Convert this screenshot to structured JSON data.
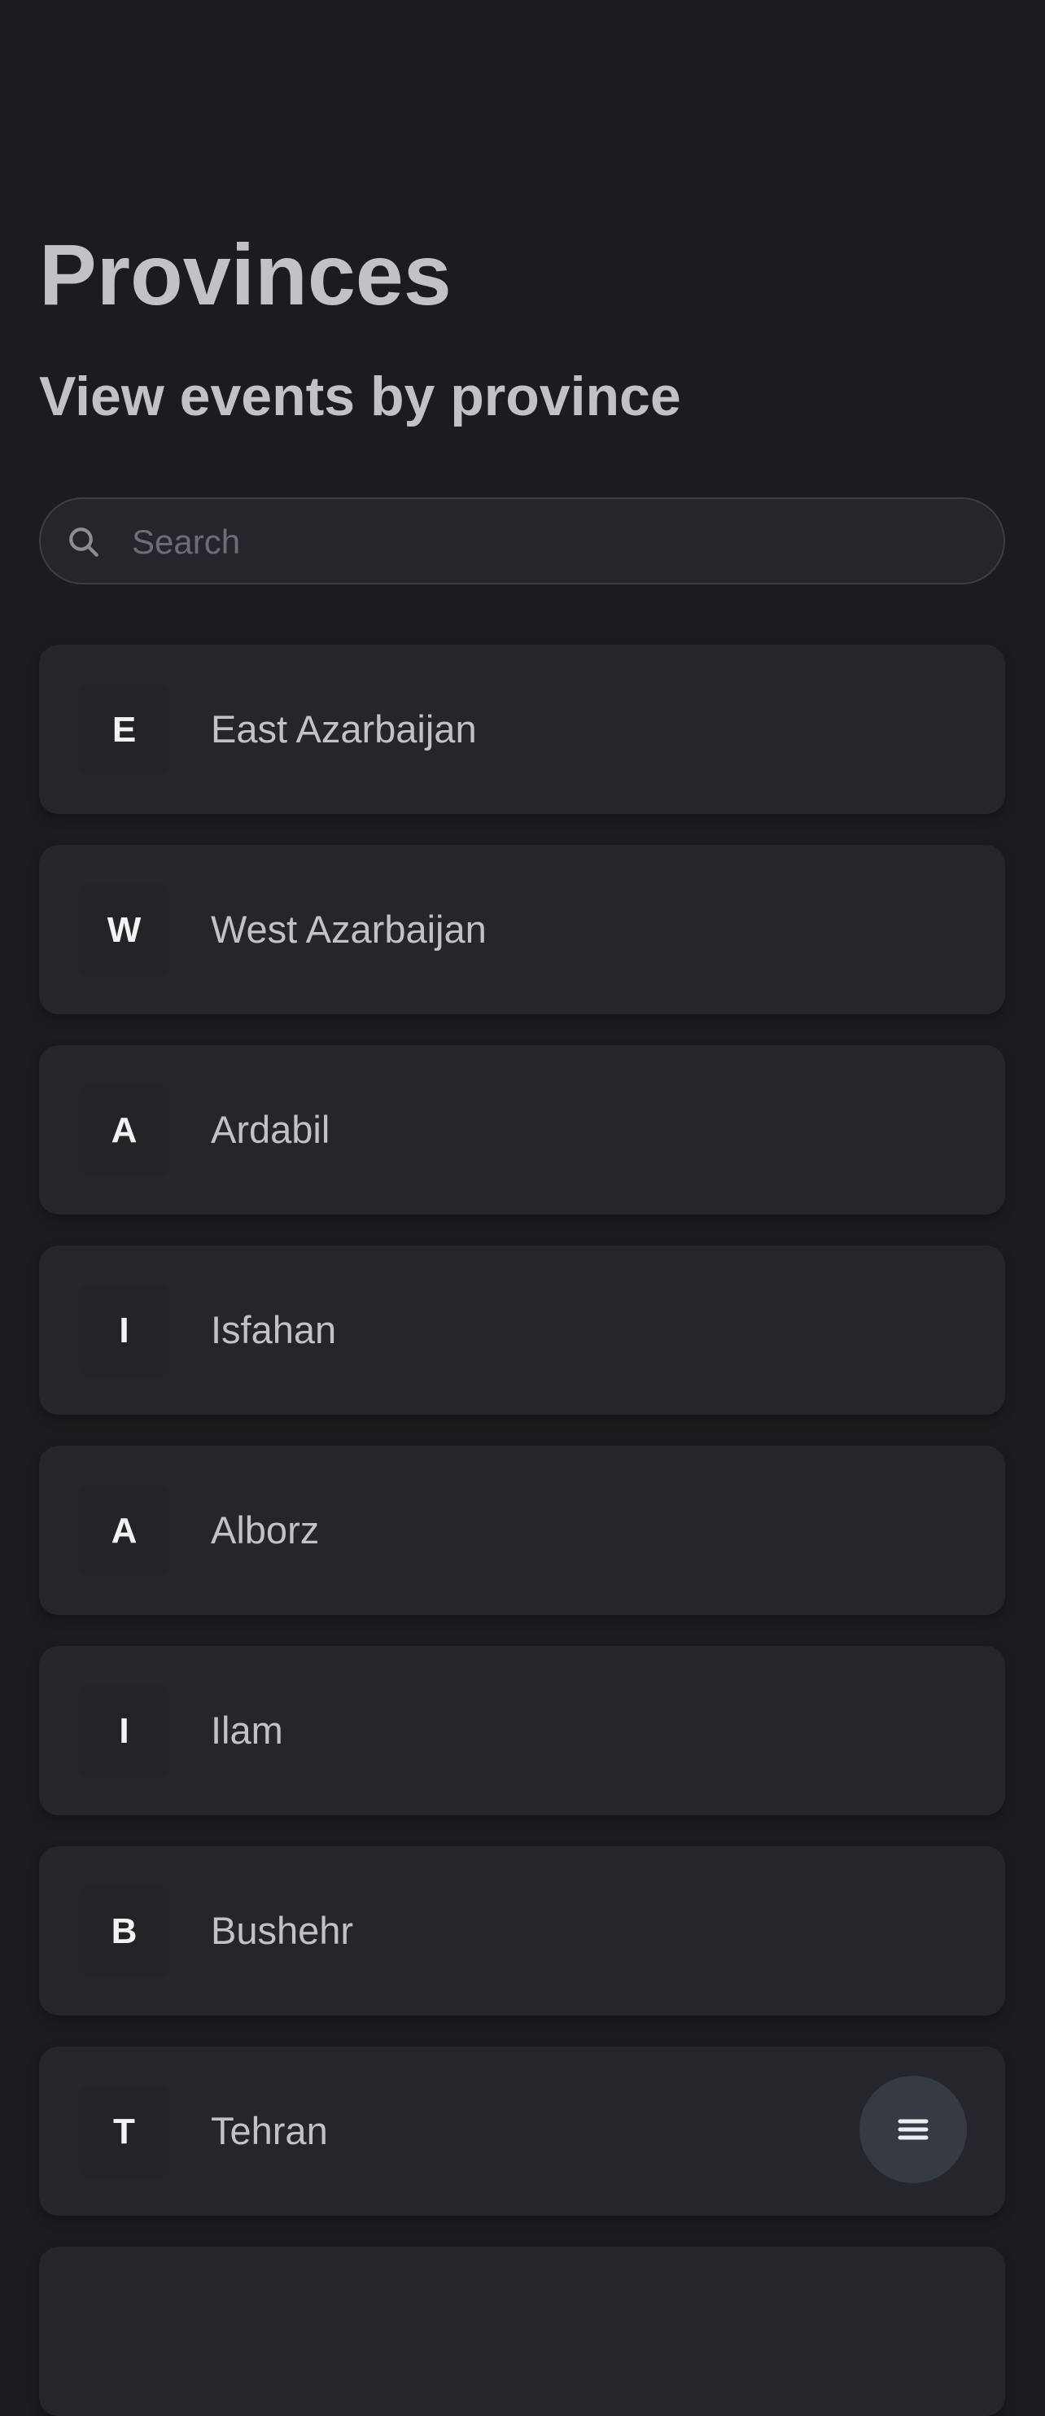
{
  "header": {
    "title": "Provinces",
    "subtitle": "View events by province"
  },
  "search": {
    "placeholder": "Search",
    "value": "",
    "icon": "search-icon"
  },
  "provinces": [
    {
      "initial": "E",
      "name": "East Azarbaijan"
    },
    {
      "initial": "W",
      "name": "West Azarbaijan"
    },
    {
      "initial": "A",
      "name": "Ardabil"
    },
    {
      "initial": "I",
      "name": "Isfahan"
    },
    {
      "initial": "A",
      "name": "Alborz"
    },
    {
      "initial": "I",
      "name": "Ilam"
    },
    {
      "initial": "B",
      "name": "Bushehr"
    },
    {
      "initial": "T",
      "name": "Tehran"
    },
    {
      "initial": "",
      "name": ""
    }
  ],
  "fab": {
    "icon": "menu-icon"
  },
  "colors": {
    "background": "#1b1c1f",
    "card": "#25262b",
    "fab": "#363a41",
    "text": "#c1c2c6"
  }
}
